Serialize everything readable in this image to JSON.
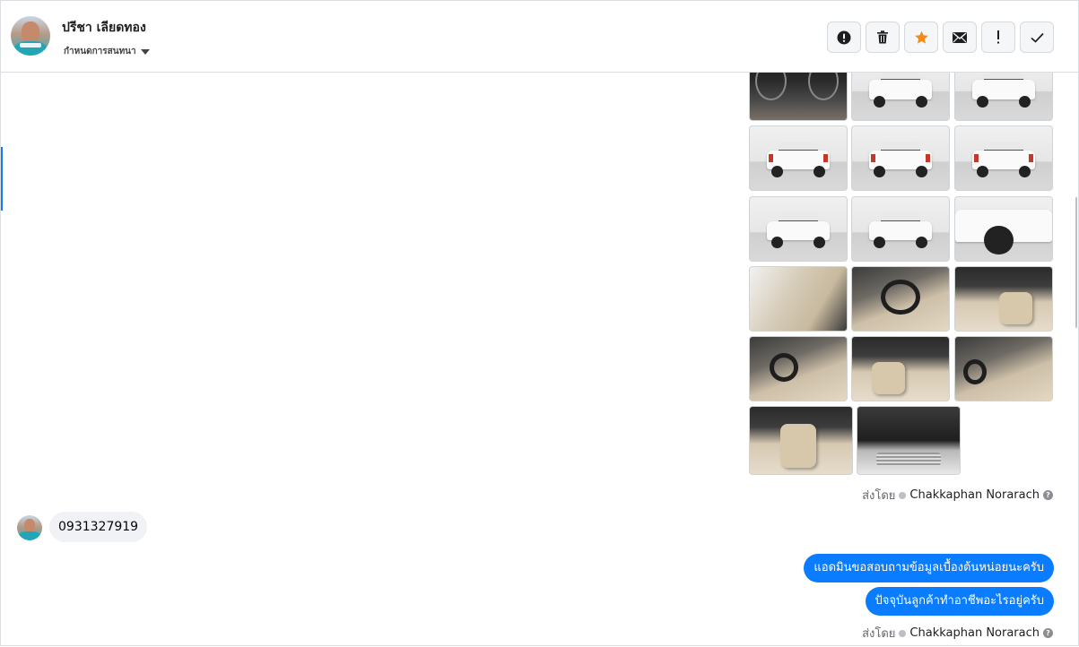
{
  "header": {
    "contact_name": "ปรีชา เลียดทอง",
    "assign_label": "กำหนดการสนทนา",
    "tools": [
      {
        "name": "spam-icon",
        "label": "!"
      },
      {
        "name": "trash-icon"
      },
      {
        "name": "star-icon",
        "color": "#f28b1e"
      },
      {
        "name": "mail-icon"
      },
      {
        "name": "exclamation-icon",
        "label": "!"
      },
      {
        "name": "check-icon"
      }
    ]
  },
  "gallery": {
    "photos": [
      "dashboard-gauges",
      "truck-front",
      "truck-front",
      "truck-rear",
      "truck-rear",
      "truck-rear",
      "truck-rear-quarter",
      "truck-side",
      "truck-wheel",
      "door-interior",
      "steering-wheel",
      "gear-shifter",
      "cabin-front",
      "cabin-seat",
      "cabin-wide",
      "rear-seat",
      "engine-bay"
    ],
    "sent_by_label": "ส่งโดย",
    "sent_by_name": "Chakkaphan Norarach"
  },
  "messages": {
    "incoming_phone": "0931327919",
    "outgoing": [
      "แอดมินขอสอบถามข้อมูลเบื้องต้นหน่อยนะครับ",
      "ปัจจุบันลูกค้าทำอาชีพอะไรอยู่ครับ"
    ],
    "sent_by_label": "ส่งโดย",
    "sent_by_name": "Chakkaphan Norarach",
    "help_icon": "?"
  }
}
